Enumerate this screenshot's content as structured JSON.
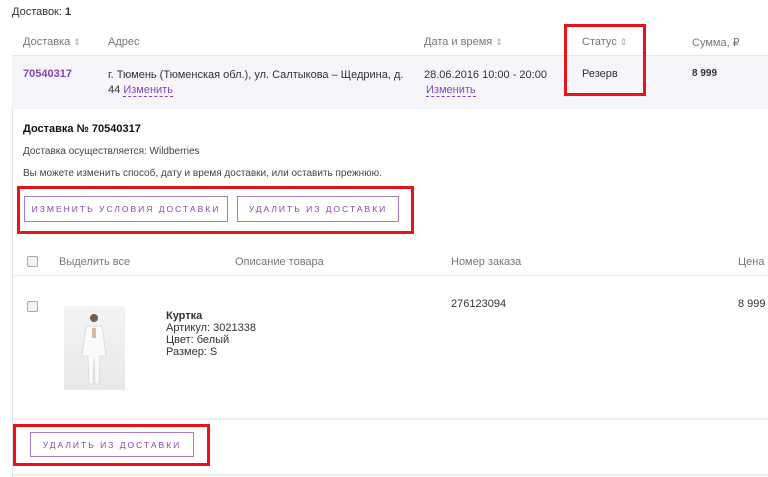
{
  "summary": {
    "label": "Доставок:",
    "count": "1"
  },
  "columns": {
    "delivery": "Доставка",
    "address": "Адрес",
    "datetime": "Дата и время",
    "status": "Статус",
    "sum": "Сумма, ₽",
    "sort_icon": "⇕"
  },
  "row": {
    "id": "70540317",
    "address": "г. Тюмень (Тюменская обл.), ул. Салтыкова – Щедрина, д.",
    "address2": "44",
    "change": "Изменить",
    "datetime": "28.06.2016 10:00 - 20:00",
    "status": "Резерв",
    "sum": "8 999"
  },
  "detail": {
    "title": "Доставка № 70540317",
    "carrier": "Доставка осуществляется: Wildberries",
    "hint": "Вы можете изменить способ, дату и время доставки, или оставить прежнюю.",
    "change_btn": "ИЗМЕНИТЬ УСЛОВИЯ ДОСТАВКИ",
    "remove_btn": "УДАЛИТЬ ИЗ ДОСТАВКИ"
  },
  "items_header": {
    "select_all": "Выделить все",
    "description": "Описание товара",
    "order_no": "Номер заказа",
    "price": "Цена"
  },
  "item": {
    "name": "Куртка",
    "article": "Артикул:  3021338",
    "color": "Цвет:  белый",
    "size": "Размер:  S",
    "order_no": "276123094",
    "price": "8 999"
  },
  "bottom": {
    "remove_btn": "УДАЛИТЬ ИЗ ДОСТАВКИ"
  },
  "colors": {
    "accent": "#8a45b0",
    "highlight": "#e8141c"
  }
}
